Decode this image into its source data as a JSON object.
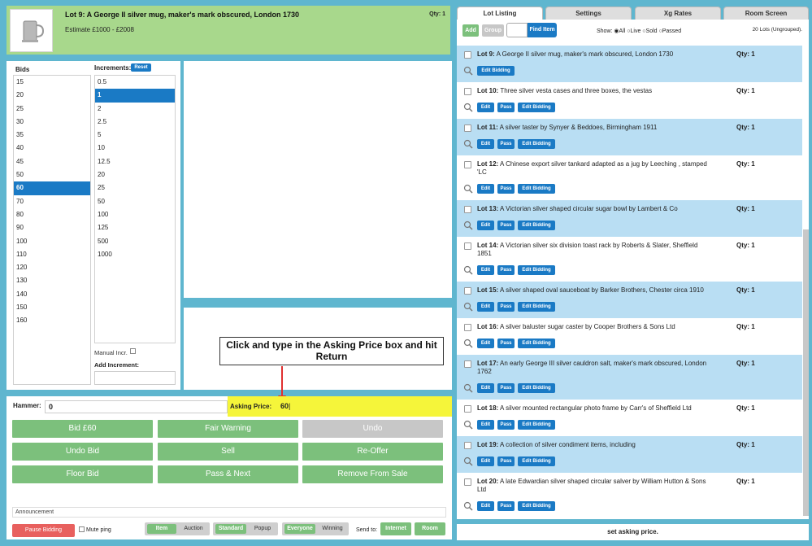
{
  "lot_header": {
    "title": "Lot 9: A George II silver mug, maker's mark obscured, London 1730",
    "estimate": "Estimate £1000 - £2008",
    "qty": "Qty: 1"
  },
  "bids": {
    "title": "Bids",
    "values": [
      "15",
      "20",
      "25",
      "30",
      "35",
      "40",
      "45",
      "50",
      "60",
      "70",
      "80",
      "90",
      "100",
      "110",
      "120",
      "130",
      "140",
      "150",
      "160"
    ],
    "selected": "60"
  },
  "increments": {
    "title": "Increments:",
    "reset_label": "Reset",
    "values": [
      "0.5",
      "1",
      "2",
      "2.5",
      "5",
      "10",
      "12.5",
      "20",
      "25",
      "50",
      "100",
      "125",
      "500",
      "1000"
    ],
    "selected": "1",
    "manual_label": "Manual Incr.",
    "add_label": "Add Increment:"
  },
  "callout": {
    "text": "Click and type in the Asking Price box and hit Return"
  },
  "controls": {
    "hammer_label": "Hammer:",
    "hammer_value": "0",
    "asking_label": "Asking Price:",
    "asking_value": "60",
    "buttons": [
      "Bid £60",
      "Fair Warning",
      "Undo",
      "Undo Bid",
      "Sell",
      "Re-Offer",
      "Floor Bid",
      "Pass & Next",
      "Remove From Sale"
    ],
    "announcement_label": "Announcement",
    "pause_label": "Pause Bidding",
    "mute_label": "Mute ping",
    "toggle1": [
      "Item",
      "Auction"
    ],
    "toggle2": [
      "Standard",
      "Popup"
    ],
    "toggle3": [
      "Everyone",
      "Winning"
    ],
    "send_to_label": "Send to:",
    "send_internet": "Internet",
    "send_room": "Room"
  },
  "right_panel": {
    "tabs": [
      "Lot Listing",
      "Settings",
      "Xg Rates",
      "Room Screen"
    ],
    "active_tab": "Lot Listing",
    "add_label": "Add",
    "group_label": "Group",
    "find_label": "Find Item",
    "show_label": "Show:",
    "show_options": [
      "All",
      "Live",
      "Sold",
      "Passed"
    ],
    "lot_count": "20 Lots (Ungrouped).",
    "lots": [
      {
        "num": "Lot 9:",
        "desc": "A George II silver mug, maker's mark obscured, London 1730",
        "qty": "Qty: 1",
        "buttons": [
          "Edit Bidding"
        ]
      },
      {
        "num": "Lot 10:",
        "desc": "Three silver vesta cases and three boxes, the vestas",
        "qty": "Qty: 1",
        "buttons": [
          "Edit",
          "Pass",
          "Edit Bidding"
        ]
      },
      {
        "num": "Lot 11:",
        "desc": "A silver taster by Synyer & Beddoes, Birmingham 1911",
        "qty": "Qty: 1",
        "buttons": [
          "Edit",
          "Pass",
          "Edit Bidding"
        ]
      },
      {
        "num": "Lot 12:",
        "desc": "A Chinese export silver tankard adapted as a jug by Leeching , stamped 'LC",
        "qty": "Qty: 1",
        "buttons": [
          "Edit",
          "Pass",
          "Edit Bidding"
        ]
      },
      {
        "num": "Lot 13:",
        "desc": "A Victorian silver shaped circular sugar bowl by Lambert & Co",
        "qty": "Qty: 1",
        "buttons": [
          "Edit",
          "Pass",
          "Edit Bidding"
        ]
      },
      {
        "num": "Lot 14:",
        "desc": "A Victorian silver six division toast rack by Roberts & Slater, Sheffield 1851",
        "qty": "Qty: 1",
        "buttons": [
          "Edit",
          "Pass",
          "Edit Bidding"
        ]
      },
      {
        "num": "Lot 15:",
        "desc": "A silver shaped oval sauceboat by Barker Brothers, Chester circa 1910",
        "qty": "Qty: 1",
        "buttons": [
          "Edit",
          "Pass",
          "Edit Bidding"
        ]
      },
      {
        "num": "Lot 16:",
        "desc": "A silver baluster sugar caster by Cooper Brothers & Sons Ltd",
        "qty": "Qty: 1",
        "buttons": [
          "Edit",
          "Pass",
          "Edit Bidding"
        ]
      },
      {
        "num": "Lot 17:",
        "desc": "An early George III silver cauldron salt, maker's mark obscured, London 1762",
        "qty": "Qty: 1",
        "buttons": [
          "Edit",
          "Pass",
          "Edit Bidding"
        ]
      },
      {
        "num": "Lot 18:",
        "desc": "A silver mounted rectangular photo frame by Carr's of Sheffield Ltd",
        "qty": "Qty: 1",
        "buttons": [
          "Edit",
          "Pass",
          "Edit Bidding"
        ]
      },
      {
        "num": "Lot 19:",
        "desc": "A collection of silver condiment items, including",
        "qty": "Qty: 1",
        "buttons": [
          "Edit",
          "Pass",
          "Edit Bidding"
        ]
      },
      {
        "num": "Lot 20:",
        "desc": "A late Edwardian silver shaped circular salver by William Hutton & Sons Ltd",
        "qty": "Qty: 1",
        "buttons": [
          "Edit",
          "Pass",
          "Edit Bidding"
        ]
      }
    ],
    "status": "set asking price."
  },
  "colors": {
    "background": "#5fb6cf",
    "header_green": "#a8d88c",
    "button_green": "#7cc07c",
    "button_blue": "#1a7ac5",
    "highlight_yellow": "#f5f53a",
    "row_blue": "#b9def3",
    "pause_red": "#e8605e"
  }
}
